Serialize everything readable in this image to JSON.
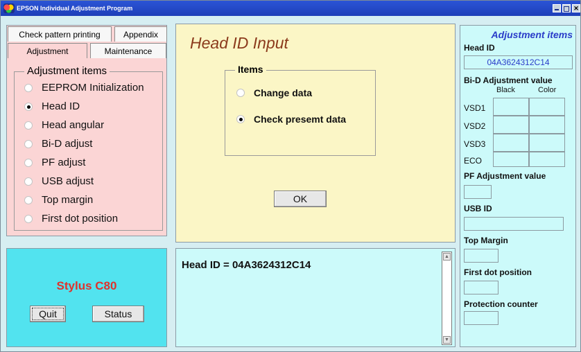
{
  "window": {
    "title": "EPSON Individual Adjustment Program"
  },
  "tabs": {
    "check_pattern": "Check pattern printing",
    "appendix": "Appendix",
    "adjustment": "Adjustment",
    "maintenance": "Maintenance"
  },
  "adjustment_items": {
    "legend": "Adjustment items",
    "options": [
      {
        "label": "EEPROM Initialization",
        "checked": false
      },
      {
        "label": "Head ID",
        "checked": true
      },
      {
        "label": "Head angular",
        "checked": false
      },
      {
        "label": "Bi-D adjust",
        "checked": false
      },
      {
        "label": "PF adjust",
        "checked": false
      },
      {
        "label": "USB adjust",
        "checked": false
      },
      {
        "label": "Top margin",
        "checked": false
      },
      {
        "label": "First dot position",
        "checked": false
      }
    ]
  },
  "main": {
    "title": "Head ID Input",
    "items_legend": "Items",
    "options": [
      {
        "label": "Change data",
        "checked": false
      },
      {
        "label": "Check presemt data",
        "checked": true
      }
    ],
    "ok_label": "OK"
  },
  "printer": {
    "model": "Stylus C80",
    "quit_label": "Quit",
    "status_label": "Status"
  },
  "log": {
    "text": "Head ID = 04A3624312C14"
  },
  "right_panel": {
    "title": "Adjustment items",
    "head_id_label": "Head ID",
    "head_id_value": "04A3624312C14",
    "bid_label": "Bi-D Adjustment value",
    "col_black": "Black",
    "col_color": "Color",
    "rows": [
      "VSD1",
      "VSD2",
      "VSD3",
      "ECO"
    ],
    "pf_label": "PF Adjustment value",
    "usb_label": "USB ID",
    "top_margin_label": "Top Margin",
    "first_dot_label": "First dot position",
    "protection_label": "Protection counter"
  },
  "colors": {
    "titlebar": "#2b54d6",
    "left_panel": "#fbd5d5",
    "center_panel": "#fbf6c6",
    "info_panel": "#ccfafa",
    "model_panel": "#52e3ef",
    "model_text": "#e0322c",
    "accent_blue": "#2a3cc9"
  }
}
